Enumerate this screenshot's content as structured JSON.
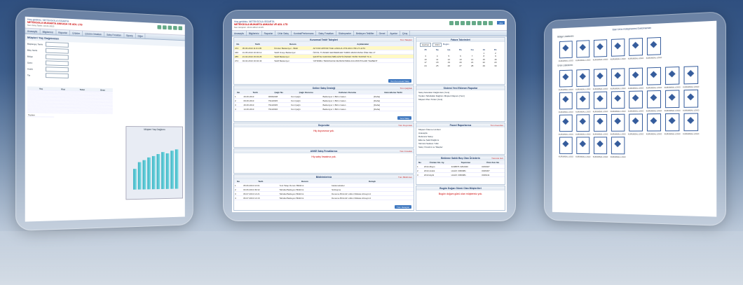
{
  "left_screen": {
    "header_line1": "Hoş geldiniz, NETEKSOLA ISSARTA",
    "header_line2": "NETEKSOLA MUHARTA ANKASA VE ADL LTD",
    "header_line3": "Son Giriş Tarihi: 16.01.2013",
    "nav": [
      "Anasayfa",
      "Bilgileriniz",
      "Raporlar",
      "Ürünler",
      "Çözüm Ortakları",
      "Satış Fırsatları",
      "Sipariş",
      "Diğer"
    ],
    "page_title": "Müşteri Yaş Dağılımları",
    "form_labels": [
      "Başlangıç Tarihi",
      "Bitiş Tarihi",
      "Bölge",
      "Şube",
      "Aralık",
      "Tip"
    ],
    "grid_headers": [
      "Yaş",
      "Kişi",
      "Tutar",
      "Oran"
    ],
    "chart_title": "Müşteri Yaş Dağılımı",
    "total_label": "Toplam",
    "chart_data": {
      "type": "bar",
      "categories": [
        "",
        "",
        "",
        "",
        "",
        "",
        "",
        "",
        "",
        ""
      ],
      "values": [
        32,
        42,
        45,
        50,
        52,
        55,
        58,
        56,
        60,
        62
      ]
    }
  },
  "mid_screen": {
    "header_line1": "Hoş geldiniz, NETEKSOLA ISSARTA",
    "header_line2": "NETEKSOLA MUHARTA ANKASA VE ADL LTD",
    "header_line3": "Son Girişiniz: 16.01.2013 13:45",
    "search_button": "Ara",
    "nav": [
      "Anasayfa",
      "Bilgileriniz",
      "Raporlar",
      "Ürün Satış",
      "Kontrat/Performans",
      "Satış Fırsatları",
      "Sözleşmeler",
      "Bekleyen Teklifler",
      "Genel",
      "Ayarlar",
      "Çıkış"
    ],
    "panels": {
      "quotes": {
        "title": "Kurumsal Teklif Talepleri",
        "more": "Tüm Talepler",
        "headers": [
          "No",
          "Tarih",
          "Durum",
          "Açıklamalar"
        ],
        "rows": [
          [
            "474",
            "05.06.2013 11:01:05",
            "Ürünler Bekleniyor - Bildir",
            "AP FOR APPOR THE LANGUA 1TR-3AN 1TR1-TL ETC"
          ],
          [
            "346",
            "31.05.2013 16:30:12",
            "Teklif Onayı Bekleniyor",
            "ÖZYAL TUNCER GENSIERLER TAMIR ARAM MANA ÖNE FEL LT"
          ],
          [
            "285",
            "21.04.2013 15:03:25",
            "Teklif Bekleniyor",
            "ŞANTİYE KADODA İSBİLGİSTİCİ BASKİ TATİR TASTIRİ TC A"
          ],
          [
            "274",
            "04.04.2013 16:02:43",
            "Teklif Bekleniyor",
            "YATIRIMLI TEMASLICE NE BASOSMALICA MONTOLARI TELBENT"
          ]
        ],
        "button": "Yeni Kurumsal Talep"
      },
      "calls": {
        "title": "Online Satış Desteği",
        "more": "Tüm Çağrılar",
        "headers": [
          "No",
          "Tarih",
          "Çağrı No",
          "Çağrı Durumu",
          "Kullanıcı Durumu",
          "Güncelleme Tarihi"
        ],
        "rows": [
          [
            "1",
            "29.06.2013",
            "00962038",
            "Yeni Çağrı",
            "Bekleniyor 1 Birim Gelen",
            "[Daha]"
          ],
          [
            "2",
            "09.06.2013",
            "79122945",
            "Yeni Çağrı",
            "Bekleniyor 1 Birim Gelen",
            "[Daha]"
          ],
          [
            "3",
            "26.06.2013",
            "79122945",
            "Yeni Çağrı",
            "Bekleniyor 1 Birim Gelen",
            "[Daha]"
          ],
          [
            "4",
            "14.06.2013",
            "79122946",
            "Yeni Çağrı",
            "Bekleniyor 1 Birim Gelen",
            "[Daha]"
          ]
        ],
        "button": "Yeni Talep"
      },
      "shipments": {
        "title": "Duyurular",
        "more": "Tüm Duyurular",
        "empty": "Hiç duyurunuz yok."
      },
      "anket": {
        "title": "ANKE Satış Fırsatlarınız",
        "more": "Tüm Fırsatlar",
        "empty": "Hiç satış fırsatınız yok."
      },
      "notices": {
        "title": "Bildirimleriniz",
        "more": "Tüm Bildirimler",
        "headers": [
          "No",
          "Tarih",
          "Durum",
          "Detaylı"
        ],
        "rows": [
          [
            "1",
            "05.06.2013 10:01",
            "Yeni Talep Durum Bildirimi",
            "beklemekteler"
          ],
          [
            "2",
            "03.06.2013 09:32",
            "Tahsilat Bekleyen Bildirimi",
            "Sözleşme"
          ],
          [
            "3",
            "06.07.2013 14:21",
            "Tahsilat Bekleyen Bildirimi",
            "Deneme Birimdir Lütfen Dikkate Almayınız"
          ],
          [
            "4",
            "06.07.2013 14:16",
            "Tahsilat Bekleyen Bildirimi",
            "Deneme Birimdir Lütfen Dikkate Almayınız"
          ]
        ],
        "button": "Tüm Detaylar"
      },
      "calendar": {
        "title": "Fatura Takvimleri",
        "month": "Haziran",
        "year": "2013",
        "today_btn": "Bugün",
        "days": [
          "Pt",
          "Sa",
          "Ça",
          "Pe",
          "Cu",
          "Ct",
          "Pz"
        ],
        "dates": [
          "",
          "",
          "",
          "",
          "",
          "1",
          "2",
          "3",
          "4",
          "5",
          "6",
          "7",
          "8",
          "9",
          "10",
          "11",
          "12",
          "13",
          "14",
          "15",
          "16",
          "17",
          "18",
          "19",
          "20",
          "21",
          "22",
          "23",
          "24",
          "25",
          "26",
          "27",
          "28",
          "29",
          "30"
        ]
      },
      "reports": {
        "title": "Sistemi Yeni Eklenen Raporlar",
        "items": [
          "Satış Faturaları Dağılımları [Yeni]",
          "Toplam Tahsilatlar Dağılımı Müşteri Raporu [Yeni]",
          "Müşteri Plan Türleri [Yeni]"
        ]
      },
      "favorites": {
        "title": "Favori Raporlarınız",
        "more": "Tüm Favoriler",
        "items": [
          "Müşteri Ödeme Limitleri",
          "Anasayfa",
          "Referans Satışı",
          "Ekleme Şekli Dağılımı",
          "Tahmini Satılanı Yıllık",
          "Satış Yönetimi ve Talepler"
        ]
      },
      "overdue": {
        "title": "Bekleme Saklü Boş Olan Ürünlerin",
        "more": "Tümünü Gör",
        "headers": [
          "No",
          "Ürünler Kd. Ay.",
          "Taşınmaz",
          "Ürün Kut. No"
        ],
        "rows": [
          [
            "1",
            "2014-Mayıs",
            "3248876 3294040",
            "3230027"
          ],
          [
            "2",
            "2013-Aralık",
            "HALİK 3399981",
            "3046307"
          ],
          [
            "3",
            "2013-Eylül",
            "HALİK 3399981",
            "3046411"
          ]
        ]
      },
      "birthdays": {
        "title": "Bugün Doğan Gümü Olan Müşterileri",
        "empty": "Bugün doğum günü olan müşteriniz yok."
      }
    }
  },
  "right_screen": {
    "title": "İdari Ürün Kütüphanesi Dokümanları",
    "section1": "Bölge Listelerim",
    "section2": "Ürün Listelerim",
    "tile_caption": "KURUMSAL LOGO",
    "top_tiles": 6,
    "grid_tiles": 28
  }
}
